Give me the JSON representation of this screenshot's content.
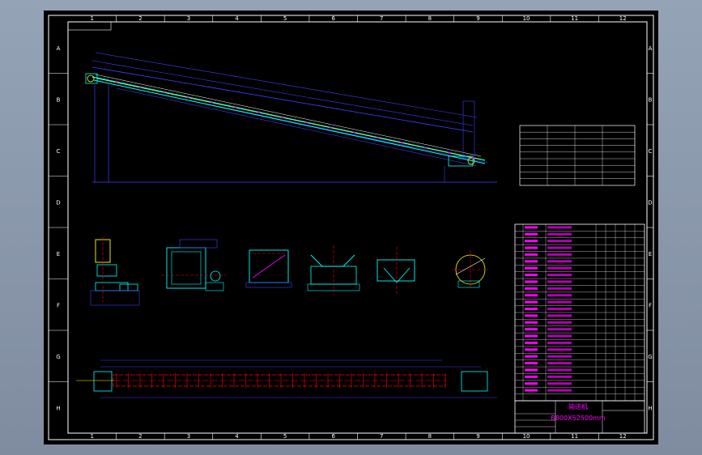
{
  "frame": {
    "col_labels": [
      "1",
      "2",
      "3",
      "4",
      "5",
      "6",
      "7",
      "8",
      "9",
      "10",
      "11",
      "12"
    ],
    "row_labels": [
      "A",
      "B",
      "C",
      "D",
      "E",
      "F",
      "G",
      "H"
    ]
  },
  "title_block": {
    "name": "输送机",
    "model": "B800X52500mm"
  },
  "colors": {
    "background": "#000000",
    "frame": "#ffffff",
    "belt": "#00ffff",
    "dims": "#4040ff",
    "centerline": "#ff0000",
    "table_magenta": "#ff00ff",
    "yellow": "#ffff00",
    "green": "#00ff00"
  }
}
